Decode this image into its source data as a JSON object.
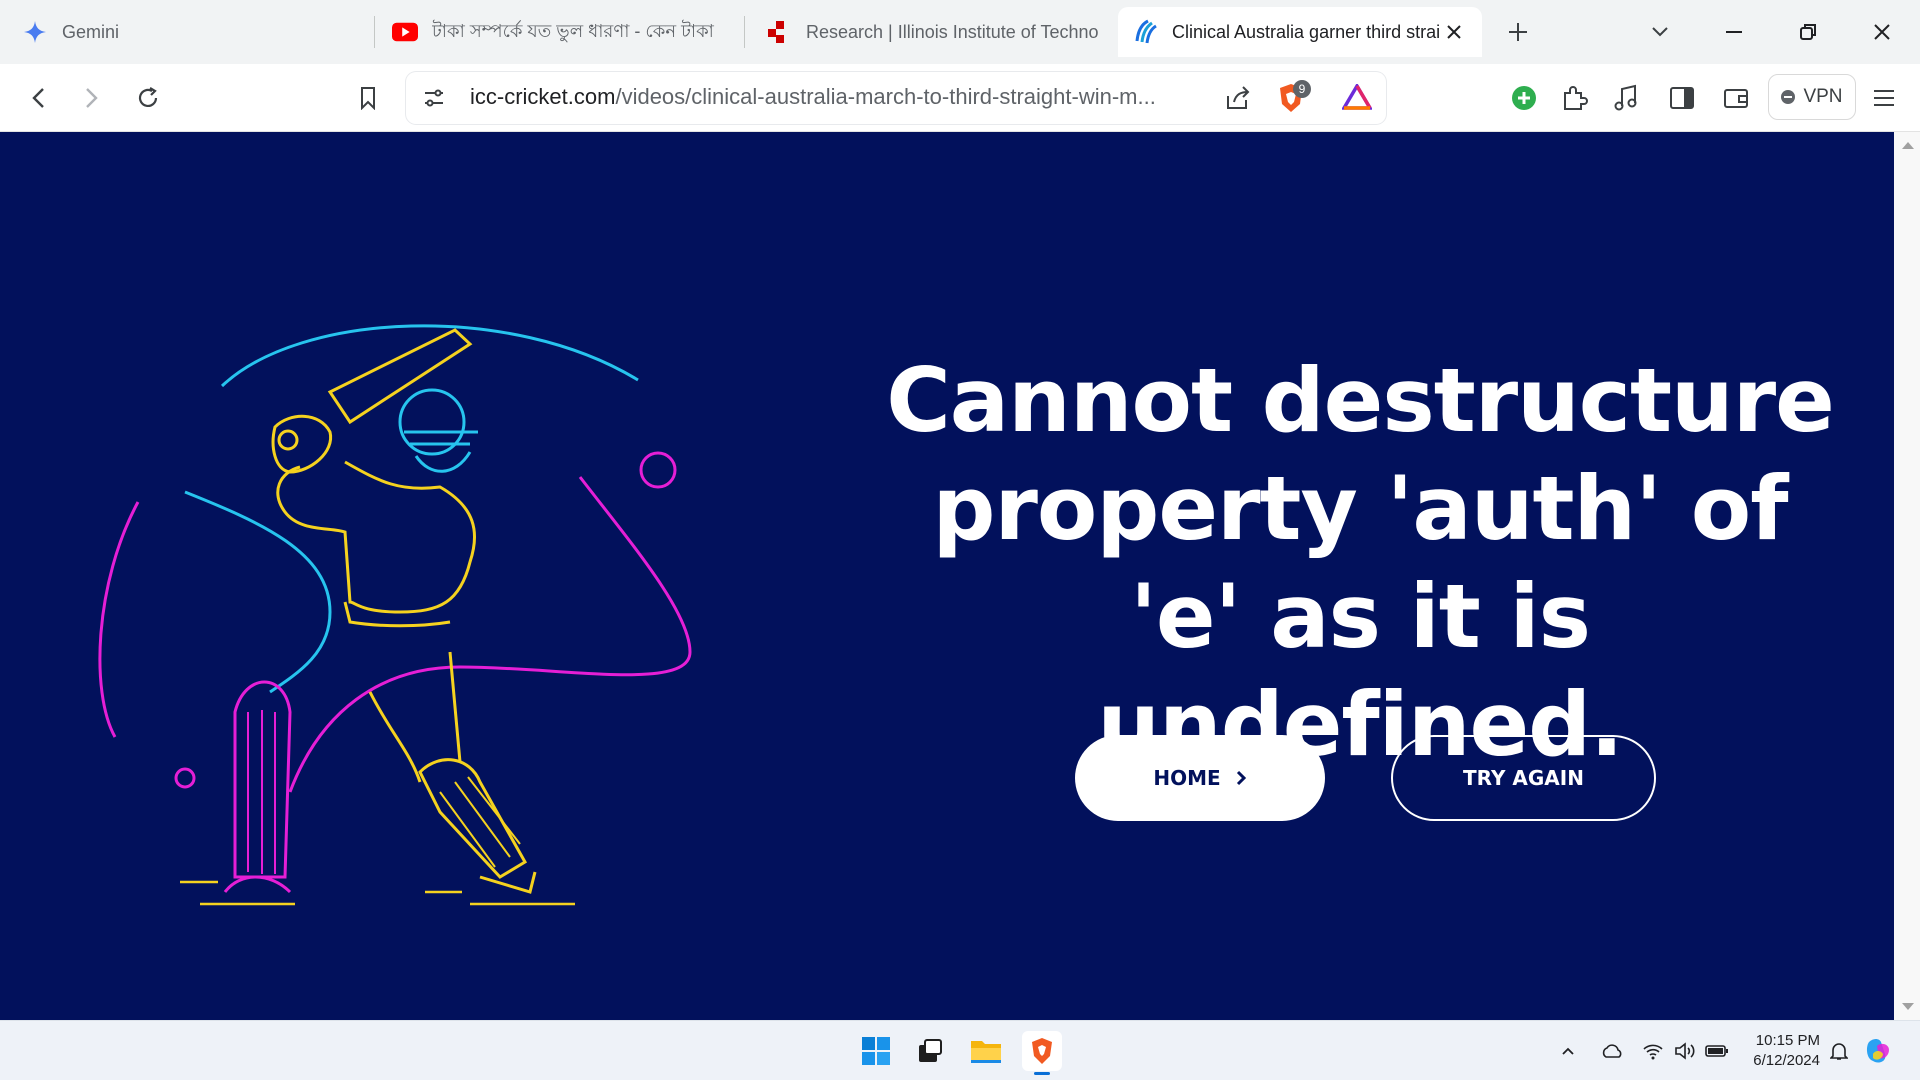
{
  "tabs": [
    {
      "title": "Gemini",
      "icon": "gemini-icon"
    },
    {
      "title": "টাকা সম্পর্কে যত ভুল ধারণা - কেন টাকা",
      "icon": "youtube-icon"
    },
    {
      "title": "Research | Illinois Institute of Technology",
      "icon": "iit-icon"
    },
    {
      "title": "Clinical Australia garner third straight win",
      "icon": "icc-icon",
      "active": true
    }
  ],
  "address_bar": {
    "domain": "icc-cricket.com",
    "path": "/videos/clinical-australia-march-to-third-straight-win-m..."
  },
  "brave_shield_count": "9",
  "vpn_label": "VPN",
  "page": {
    "error_message": "Cannot destructure property 'auth' of 'e' as it is undefined.",
    "home_button": "HOME",
    "try_again_button": "TRY AGAIN"
  },
  "colors": {
    "page_background": "#02115c",
    "accent_yellow": "#f5d21f",
    "accent_magenta": "#e51fd6",
    "accent_cyan": "#27c4ee"
  },
  "taskbar": {
    "time": "10:15 PM",
    "date": "6/12/2024"
  }
}
